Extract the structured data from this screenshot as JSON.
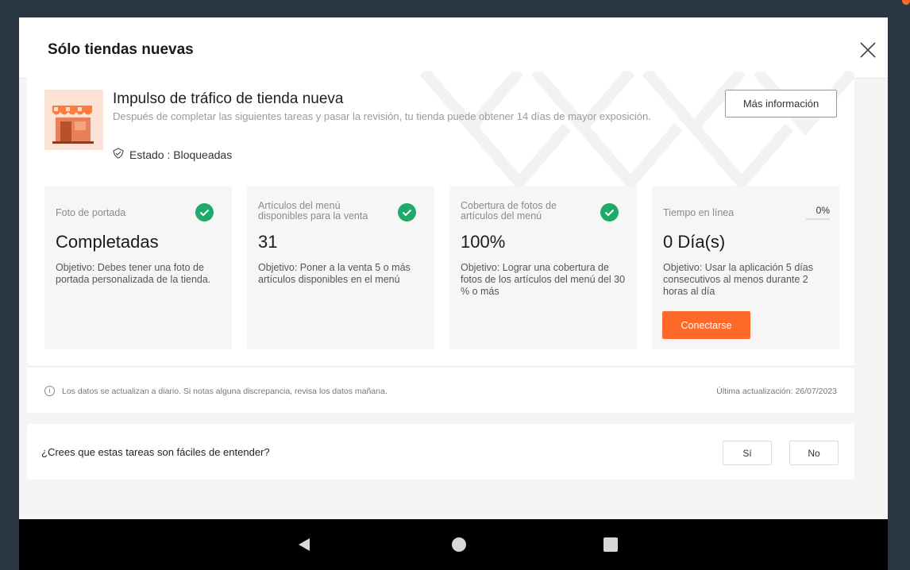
{
  "colors": {
    "accent": "#ff6a2b",
    "success": "#1fa96b",
    "overlay": "#2b3644"
  },
  "modal": {
    "title": "Sólo tiendas nuevas"
  },
  "campaign": {
    "title": "Impulso de tráfico de tienda nueva",
    "description": "Después de completar las siguientes tareas y pasar la revisión, tu tienda puede obtener 14 días de mayor exposición.",
    "status": "Estado : Bloqueadas",
    "info_button": "Más información"
  },
  "tasks": [
    {
      "name": "Foto de portada",
      "value": "Completadas",
      "goal": "Objetivo: Debes tener una foto de portada personalizada de la tienda.",
      "done": true
    },
    {
      "name": "Artículos del menú disponibles para la venta",
      "value": "31",
      "goal": "Objetivo: Poner a la venta 5 o más artículos disponibles en el menú",
      "done": true
    },
    {
      "name": "Cobertura de fotos de artículos del menú",
      "value": "100%",
      "goal": "Objetivo: Lograr una cobertura de fotos de los artículos del menú del 30 % o más",
      "done": true
    },
    {
      "name": "Tiempo en línea",
      "value": "0 Día(s)",
      "goal": "Objetivo: Usar la aplicación 5 días consecutivos al menos durante 2 horas al día",
      "done": false,
      "progress": "0%",
      "action": "Conectarse"
    }
  ],
  "note": {
    "text": "Los datos se actualizan a diario. Si notas alguna discrepancia, revisa los datos mañana.",
    "updated": "Última actualización: 26/07/2023"
  },
  "feedback": {
    "question": "¿Crees que estas tareas son fáciles de entender?",
    "yes": "Sí",
    "no": "No"
  },
  "icons": [
    "close-icon",
    "store-icon",
    "shield-icon",
    "check-icon",
    "info-icon",
    "back-icon",
    "home-icon",
    "recents-icon"
  ]
}
